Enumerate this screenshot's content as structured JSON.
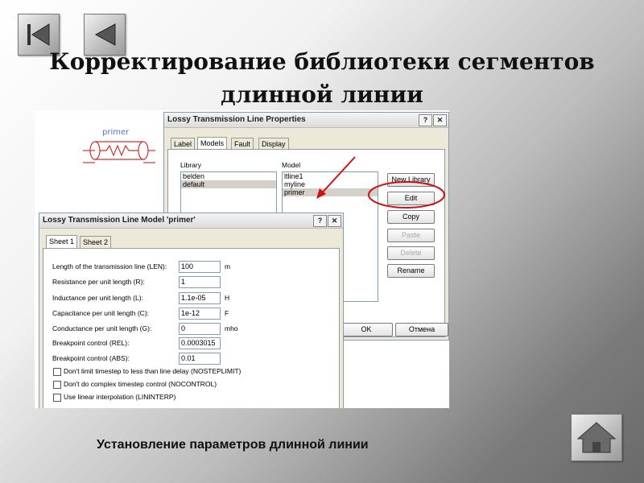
{
  "slide": {
    "title_line1": "Корректирование  библиотеки сегментов",
    "title_line2": "длинной линии",
    "caption": "Установление параметров длинной линии"
  },
  "nav": {
    "first_icon": "skip-back-icon",
    "prev_icon": "prev-icon",
    "home_icon": "home-icon"
  },
  "schematic": {
    "label": "primer"
  },
  "properties_dialog": {
    "title": "Lossy Transmission Line Properties",
    "help": "?",
    "close": "✕",
    "tabs": [
      "Label",
      "Models",
      "Fault",
      "Display"
    ],
    "library_label": "Library",
    "library_items": [
      "belden",
      "default"
    ],
    "model_label": "Model",
    "model_items": [
      "ltline1",
      "myline",
      "primer"
    ],
    "buttons": {
      "new_library": "New Library",
      "edit": "Edit",
      "copy": "Copy",
      "paste": "Paste",
      "delete": "Delete",
      "rename": "Rename",
      "ok": "OK",
      "cancel": "Отмена"
    }
  },
  "model_dialog": {
    "title": "Lossy Transmission Line Model 'primer'",
    "help": "?",
    "close": "✕",
    "tabs": [
      "Sheet 1",
      "Sheet 2"
    ],
    "params": [
      {
        "label": "Length of the transmission line (LEN):",
        "value": "100",
        "unit": "m"
      },
      {
        "label": "Resistance per unit length (R):",
        "value": "1",
        "unit": ""
      },
      {
        "label": "Inductance per unit length (L):",
        "value": "1.1e-05",
        "unit": "H"
      },
      {
        "label": "Capacitance per unit length (C):",
        "value": "1e-12",
        "unit": "F"
      },
      {
        "label": "Conductance per unit length (G):",
        "value": "0",
        "unit": "mho"
      },
      {
        "label": "Breakpoint control (REL):",
        "value": "0.0003015",
        "unit": ""
      },
      {
        "label": "Breakpoint control (ABS):",
        "value": "0.01",
        "unit": ""
      }
    ],
    "checkboxes": [
      "Don't limit timestep to less than line delay (NOSTEPLIMIT)",
      "Don't do complex timestep control (NOCONTROL)",
      "Use linear interpolation (LININTERP)"
    ]
  },
  "annotation_color": "#cc1111"
}
